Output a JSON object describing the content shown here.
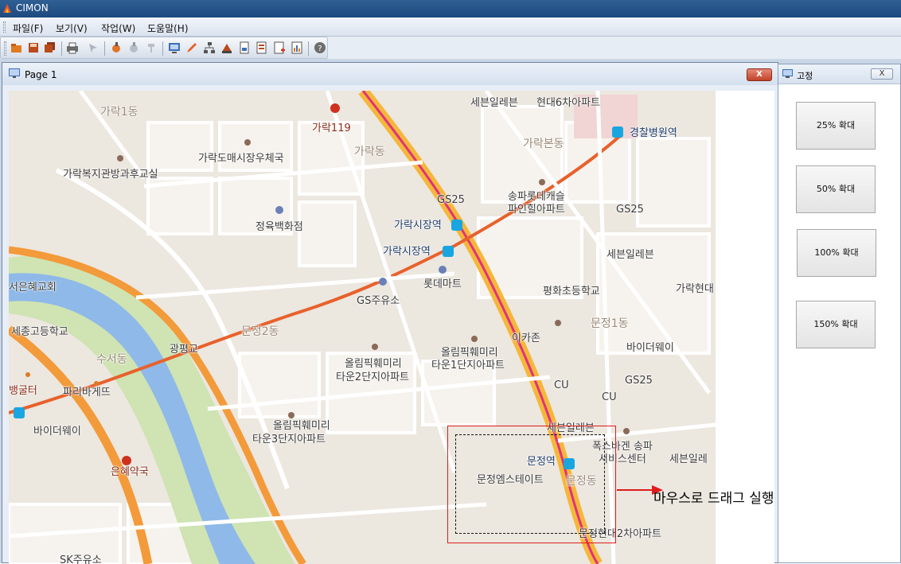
{
  "window": {
    "title": "CIMON"
  },
  "menu": [
    {
      "label": "파일(F)"
    },
    {
      "label": "보기(V)"
    },
    {
      "label": "작업(W)"
    },
    {
      "label": "도움말(H)"
    }
  ],
  "toolbar": {
    "buttons": [
      {
        "icon": "open-folder-icon"
      },
      {
        "icon": "save-icon"
      },
      {
        "icon": "save-all-icon"
      },
      {
        "icon": "print-icon"
      },
      {
        "icon": "pointer-icon"
      },
      {
        "icon": "tool-a-icon"
      },
      {
        "icon": "tool-b-icon"
      },
      {
        "icon": "tool-c-icon"
      },
      {
        "icon": "screen-icon"
      },
      {
        "icon": "pen-icon"
      },
      {
        "icon": "network-icon"
      },
      {
        "icon": "device-icon"
      },
      {
        "icon": "document-icon"
      },
      {
        "icon": "report-icon"
      },
      {
        "icon": "add-page-icon"
      },
      {
        "icon": "chart-icon"
      },
      {
        "icon": "help-icon"
      }
    ]
  },
  "page_window": {
    "title": "Page 1",
    "close_label": "X"
  },
  "side_panel": {
    "title": "고정",
    "close_label": "X",
    "buttons": [
      {
        "label": "25% 확대"
      },
      {
        "label": "50% 확대"
      },
      {
        "label": "100% 확대"
      },
      {
        "label": "150% 확대"
      }
    ]
  },
  "map": {
    "labels": [
      "세븐일레븐",
      "현대6차아파트",
      "가락1동",
      "가락119",
      "가락본동",
      "경찰병원역",
      "가락도매시장우체국",
      "가락동",
      "가락복지관방과후교실",
      "GS25",
      "송파롯데캐슬",
      "파인힐아파트",
      "GS25",
      "가락시장역",
      "정육백화점",
      "가락시장역",
      "세븐일레븐",
      "롯데마트",
      "서은혜교회",
      "평화초등학교",
      "가락현대",
      "GS주유소",
      "세종고등학교",
      "문정2동",
      "문정1동",
      "이카존",
      "바이더웨이",
      "광평교",
      "올림픽훼미리",
      "올림픽훼미리",
      "타운2단지아파트",
      "타운1단지아파트",
      "수서동",
      "CU",
      "GS25",
      "파리바게뜨",
      "CU",
      "뱅굴터",
      "세븐일레븐",
      "바이더웨이",
      "올림픽훼미리",
      "타운3단지아파트",
      "폭스바겐 송파",
      "서비스센터",
      "세븐일레",
      "문정역",
      "은혜약국",
      "문정엠스테이트",
      "문정동",
      "문정현대2차아파트",
      "SK주유소"
    ],
    "annotation": "마우스로 드래그 실행 한 부분"
  },
  "colors": {
    "titlebar": "#1d4a80",
    "selection": "#e01b1b",
    "close_button": "#c2422a",
    "subway_line": "#e8612c",
    "main_road": "#f5b73a",
    "river": "#8fb9e8"
  }
}
